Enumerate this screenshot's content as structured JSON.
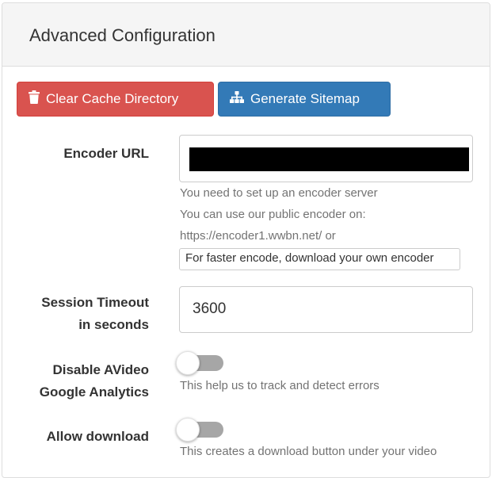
{
  "panel": {
    "title": "Advanced Configuration"
  },
  "buttons": {
    "clear_cache": {
      "label": "Clear Cache Directory",
      "icon": "trash-icon",
      "color": "#d9534f"
    },
    "generate_sitemap": {
      "label": "Generate Sitemap",
      "icon": "sitemap-icon",
      "color": "#337ab7"
    }
  },
  "encoder": {
    "label": "Encoder URL",
    "value_redacted": true,
    "help_lines": [
      "You need to set up an encoder server",
      "You can use our public encoder on:",
      "https://encoder1.wwbn.net/ or"
    ],
    "download_link": "For faster encode, download your own encoder"
  },
  "session_timeout": {
    "label_line1": "Session Timeout",
    "label_line2": "in seconds",
    "value": "3600"
  },
  "disable_analytics": {
    "label_line1": "Disable AVideo",
    "label_line2": "Google Analytics",
    "enabled": false,
    "help": "This help us to track and detect errors"
  },
  "allow_download": {
    "label": "Allow download",
    "enabled": false,
    "help": "This creates a download button under your video"
  },
  "colors": {
    "danger": "#d9534f",
    "primary": "#337ab7",
    "help_text": "#737373"
  }
}
